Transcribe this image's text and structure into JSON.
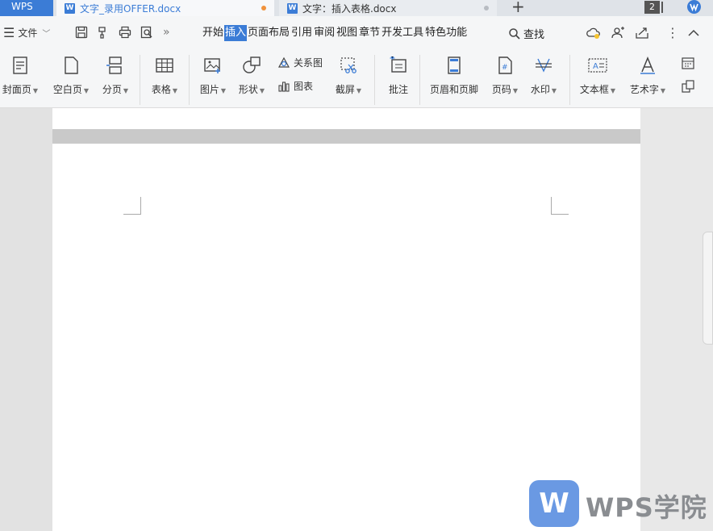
{
  "tabbar": {
    "home": "WPS",
    "tabs": [
      {
        "title": "文字_录用OFFER.docx",
        "state": "active",
        "modified": true
      },
      {
        "title": "文字：插入表格.docx",
        "state": "inactive",
        "modified": false
      }
    ],
    "new_tab": "+",
    "window_count": "2",
    "doc_icon": "W"
  },
  "menubar": {
    "file_label": "文件",
    "tabs": [
      "开始",
      "插入",
      "页面布局",
      "引用",
      "审阅",
      "视图",
      "章节",
      "开发工具",
      "特色功能"
    ],
    "active_tab": "插入",
    "search_label": "查找"
  },
  "ribbon": {
    "cover": "封面页",
    "blank": "空白页",
    "page_break": "分页",
    "table": "表格",
    "picture": "图片",
    "shape": "形状",
    "relation": "关系图",
    "chart": "图表",
    "screenshot": "截屏",
    "comment": "批注",
    "header_footer": "页眉和页脚",
    "page_number": "页码",
    "watermark": "水印",
    "textbox": "文本框",
    "wordart": "艺术字"
  },
  "watermark_brand": {
    "logo_letter": "W",
    "text": "WPS学院"
  },
  "colors": {
    "accent": "#3b7cd6",
    "modified_dot": "#f0923c"
  }
}
